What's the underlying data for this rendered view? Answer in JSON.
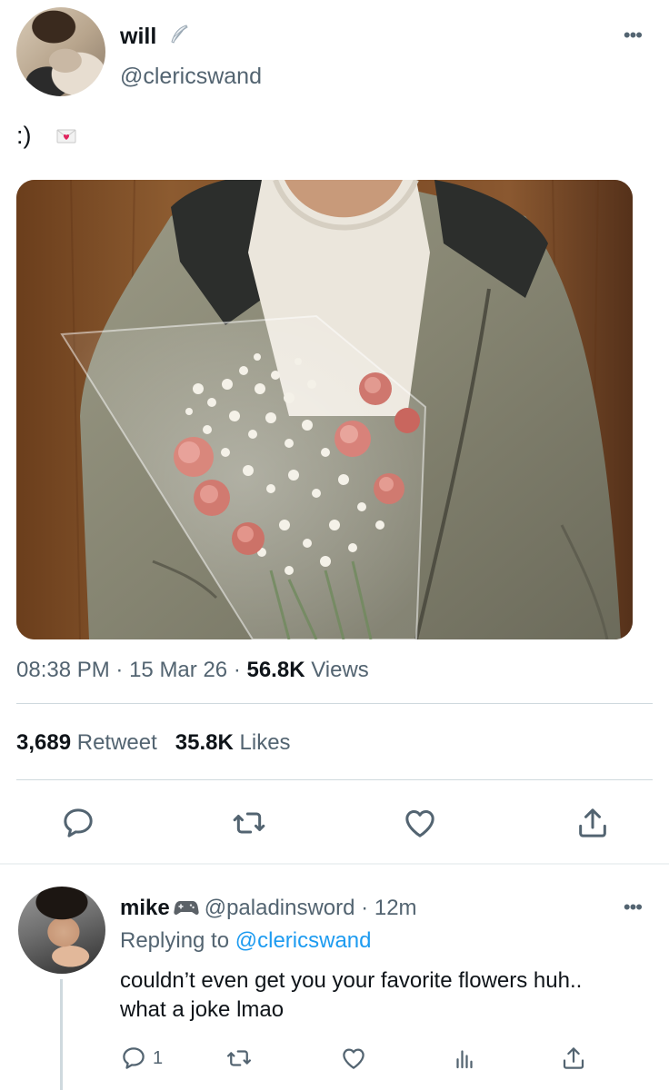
{
  "tweet": {
    "display_name": "will",
    "handle": "@clericswand",
    "text": ":)",
    "text_emoji": "love-letter-icon",
    "name_emoji": "wing-icon",
    "time": "08:38 PM",
    "date": "15 Mar 26",
    "views_count": "56.8K",
    "views_label": "Views",
    "separator": "·",
    "retweet_count": "3,689",
    "retweet_label": "Retweet",
    "likes_count": "35.8K",
    "likes_label": "Likes",
    "more_label": "•••",
    "photo_subject": "person-holding-flower-bouquet"
  },
  "reply": {
    "display_name": "mike",
    "name_emoji": "game-controller-icon",
    "handle": "@paladinsword",
    "age": "12m",
    "separator": "·",
    "replying_prefix": "Replying to",
    "replying_to": "@clericswand",
    "text": "couldn’t even get you your favorite flowers huh.. what a joke lmao",
    "reply_count": "1",
    "more_label": "•••"
  },
  "colors": {
    "text_primary": "#0f1419",
    "text_secondary": "#536471",
    "link": "#1d9bf0",
    "divider": "#cfd9de"
  }
}
